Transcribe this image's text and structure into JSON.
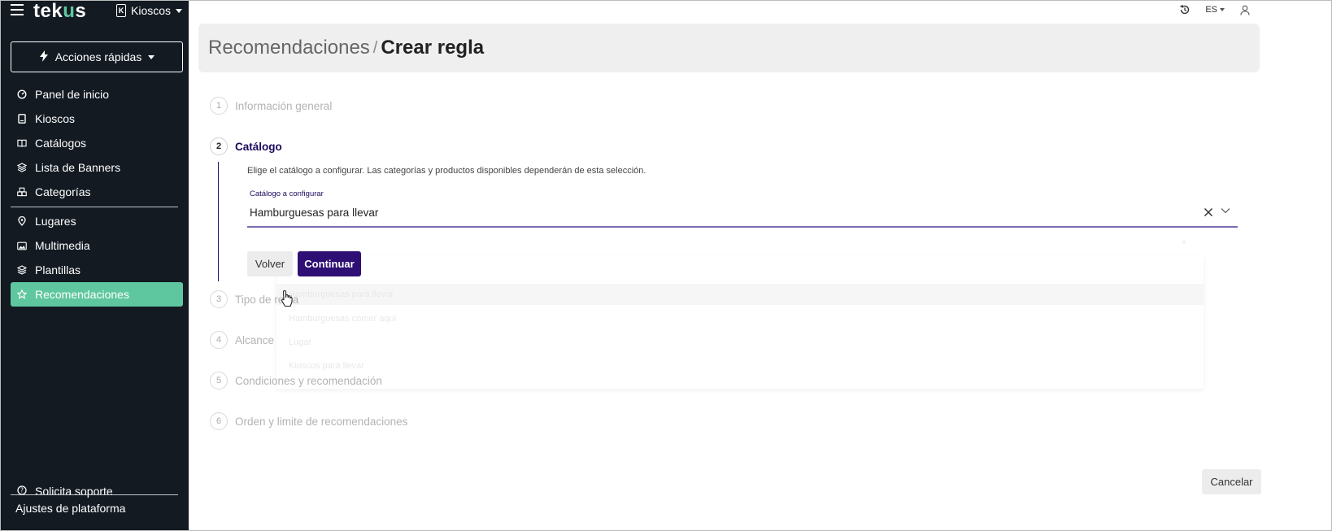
{
  "app": {
    "logo_prefix": "tek",
    "logo_accent": "u",
    "logo_suffix": "s",
    "kiosk_icon_letter": "K",
    "kiosk_label": "Kioscos"
  },
  "quick_actions": {
    "label": "Acciones rápidas"
  },
  "sidebar": {
    "group1": [
      {
        "label": "Panel de inicio",
        "icon": "dashboard-icon"
      },
      {
        "label": "Kioscos",
        "icon": "kiosk-icon"
      },
      {
        "label": "Catálogos",
        "icon": "book-icon"
      },
      {
        "label": "Lista de Banners",
        "icon": "layers-icon"
      },
      {
        "label": "Categorías",
        "icon": "boxes-icon"
      }
    ],
    "group2": [
      {
        "label": "Lugares",
        "icon": "location-icon"
      },
      {
        "label": "Multimedia",
        "icon": "image-icon"
      },
      {
        "label": "Plantillas",
        "icon": "layers-icon"
      },
      {
        "label": "Recomendaciones",
        "icon": "star-icon",
        "active": true
      }
    ],
    "support": "Solicita soporte",
    "platform": "Ajustes de plataforma"
  },
  "topbar": {
    "lang": "ES"
  },
  "header": {
    "parent": "Recomendaciones",
    "separator": "/",
    "current": "Crear regla"
  },
  "steps": [
    {
      "num": "1",
      "label": "Información general"
    },
    {
      "num": "2",
      "label": "Catálogo"
    },
    {
      "num": "3",
      "label": "Tipo de regla"
    },
    {
      "num": "4",
      "label": "Alcance"
    },
    {
      "num": "5",
      "label": "Condiciones y recomendación"
    },
    {
      "num": "6",
      "label": "Orden y limite de recomendaciones"
    }
  ],
  "catalog_step": {
    "description": "Elige el catálogo a configurar. Las categorías y productos disponibles dependerán de esta selección.",
    "field_label": "Catálogo a configurar",
    "field_value": "Hamburguesas para llevar",
    "back_label": "Volver",
    "continue_label": "Continuar"
  },
  "dropdown_ghost": [
    "Hamburguesas para llevar",
    "Hamburguesas comer aquí",
    "Lugar",
    "Kioscos para llevar"
  ],
  "cancel_label": "Cancelar",
  "colors": {
    "sidebar_bg": "#131a22",
    "accent": "#5fc7a0",
    "primary": "#2e0f73"
  }
}
